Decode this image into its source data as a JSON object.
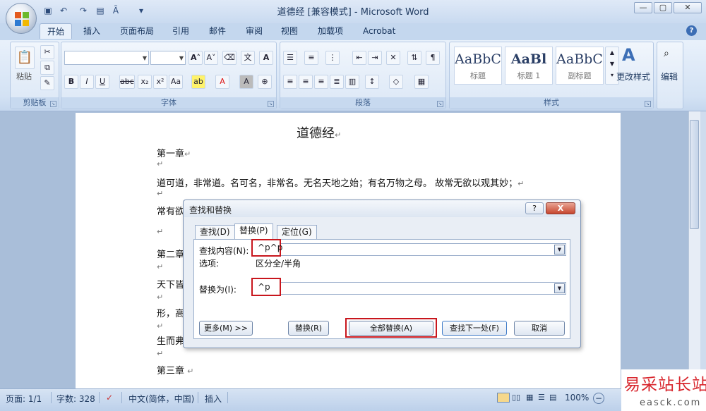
{
  "window": {
    "title": "道德经 [兼容模式] - Microsoft Word"
  },
  "ribbon": {
    "tabs": [
      "开始",
      "插入",
      "页面布局",
      "引用",
      "邮件",
      "审阅",
      "视图",
      "加载项",
      "Acrobat"
    ],
    "active_tab": "开始",
    "groups": {
      "clipboard": "剪贴板",
      "font": "字体",
      "paragraph": "段落",
      "styles": "样式"
    },
    "paste_label": "粘贴",
    "styles": [
      {
        "preview": "AaBbC",
        "name": "标题"
      },
      {
        "preview": "AaBl",
        "name": "标题 1"
      },
      {
        "preview": "AaBbC",
        "name": "副标题"
      }
    ],
    "change_styles_label": "更改样式",
    "edit_label": "编辑"
  },
  "document": {
    "title": "道德经",
    "lines": [
      "第一章",
      "道可道，非常道。名可名，非常名。无名天地之始；有名万物之母。 故常无欲以观其妙；",
      "常有欲",
      "第二章",
      "天下皆",
      "形，高",
      "生而弗",
      "第三章"
    ]
  },
  "dialog": {
    "title": "查找和替换",
    "tabs": [
      "查找(D)",
      "替换(P)",
      "定位(G)"
    ],
    "active_tab": "替换(P)",
    "find_label": "查找内容(N):",
    "find_value": "^p^p",
    "options_label": "选项:",
    "options_value": "区分全/半角",
    "replace_label": "替换为(I):",
    "replace_value": "^p",
    "buttons": {
      "more": "更多(M) >>",
      "replace": "替换(R)",
      "replace_all": "全部替换(A)",
      "find_next": "查找下一处(F)",
      "cancel": "取消"
    },
    "help": "?",
    "close": "X"
  },
  "statusbar": {
    "page": "页面: 1/1",
    "words": "字数: 328",
    "language": "中文(简体，中国)",
    "mode": "插入",
    "zoom": "100%"
  },
  "watermark": {
    "text": "易采站长站",
    "url": "easck.com"
  },
  "colors": {
    "highlight": "#c8161d",
    "ribbon": "#d3e2f4",
    "accent": "#3b6db4"
  }
}
